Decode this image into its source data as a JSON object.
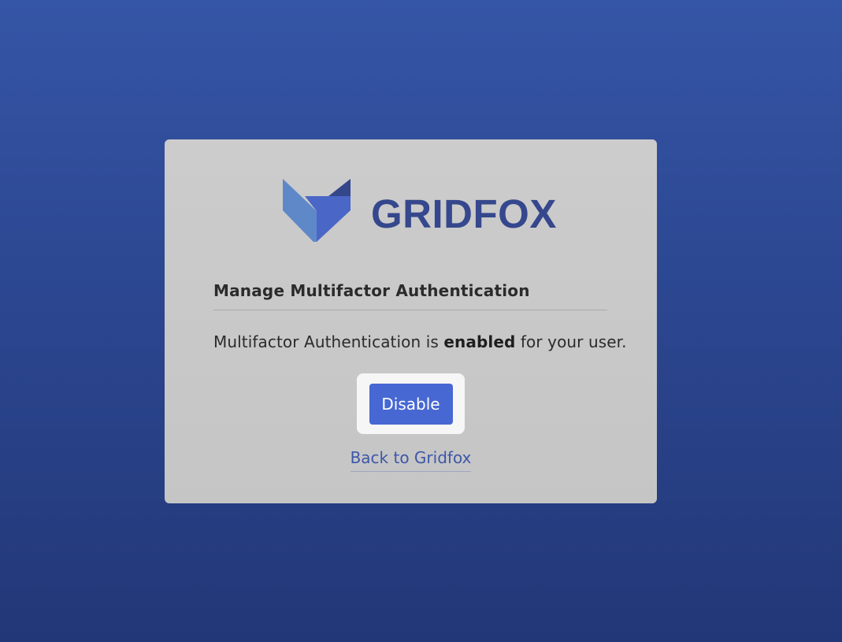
{
  "brand": {
    "name": "GRIDFOX",
    "colors": {
      "text": "#35478d",
      "mark_light": "#5f88c8",
      "mark_mid": "#4a66c7",
      "mark_dark": "#34478a"
    }
  },
  "panel": {
    "title": "Manage Multifactor Authentication",
    "status": {
      "prefix": "Multifactor Authentication is ",
      "state": "enabled",
      "suffix": " for your user."
    },
    "disable_button": "Disable",
    "back_link": "Back to Gridfox"
  },
  "colors": {
    "background_top": "#3555a6",
    "background_bottom": "#223777",
    "button": "#4767d3",
    "link": "#3d57a8"
  }
}
